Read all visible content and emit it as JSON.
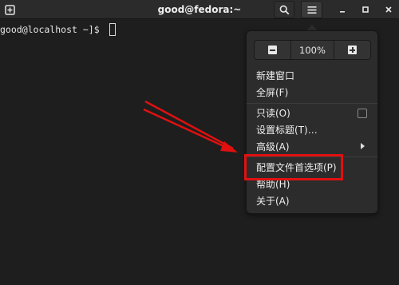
{
  "window": {
    "title": "good@fedora:~"
  },
  "terminal": {
    "prompt": "good@localhost ~]$ "
  },
  "menu": {
    "zoom_value": "100%",
    "items": {
      "new_window": "新建窗口",
      "fullscreen": "全屏(F)",
      "read_only": "只读(O)",
      "set_title": "设置标题(T)…",
      "advanced": "高级(A)",
      "preferences": "配置文件首选项(P)",
      "help": "帮助(H)",
      "about": "关于(A)"
    },
    "read_only_checked": false
  },
  "annotation": {
    "highlight_color": "#e01010",
    "arrow_color": "#e01010"
  },
  "icons": {
    "new_tab": "new-tab-icon",
    "search": "search-icon",
    "menu": "hamburger-menu-icon",
    "minimize": "minimize-icon",
    "maximize": "maximize-icon",
    "close": "close-icon"
  }
}
